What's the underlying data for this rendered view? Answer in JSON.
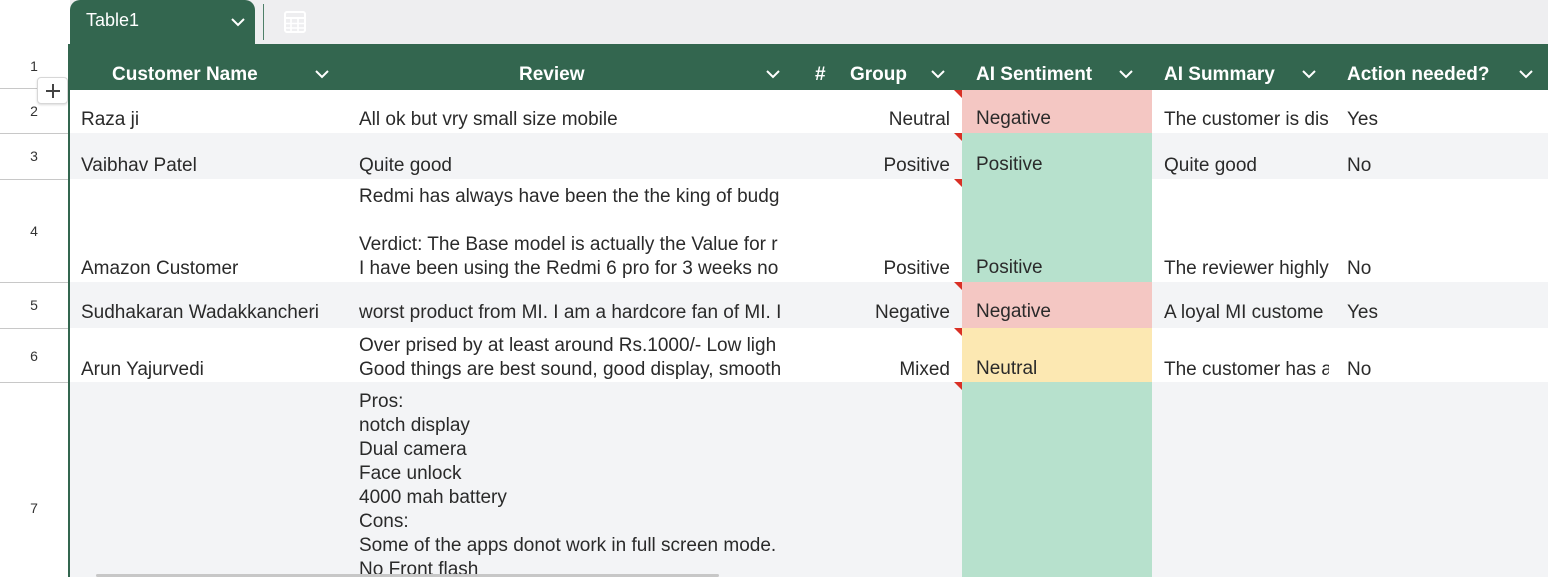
{
  "tab": {
    "name": "Table1",
    "chevron_icon": "chevron-down-icon",
    "table_icon": "table-view-icon"
  },
  "row_numbers": [
    "1",
    "2",
    "3",
    "4",
    "5",
    "6",
    "7"
  ],
  "columns": {
    "customer_name": "Customer Name",
    "review": "Review",
    "group_hash": "#",
    "group": "Group",
    "ai_sentiment": "AI Sentiment",
    "ai_summary": "AI Summary",
    "action_needed": "Action needed?"
  },
  "colors": {
    "header_bg": "#33664f",
    "negative": "#f4c7c3",
    "positive": "#b7e1cd",
    "neutral": "#fce8b2",
    "comment_flag": "#d93025"
  },
  "rows": [
    {
      "customer_name": "Raza ji",
      "review": "All ok but vry small size mobile",
      "group": "Neutral",
      "ai_sentiment": "Negative",
      "ai_summary": "The customer is dis",
      "action_needed": "Yes"
    },
    {
      "customer_name": "Vaibhav Patel",
      "review": "Quite good",
      "group": "Positive",
      "ai_sentiment": "Positive",
      "ai_summary": "Quite good",
      "action_needed": "No"
    },
    {
      "customer_name": "Amazon Customer",
      "review": "Redmi has always have been the the king of budg\n\nVerdict: The Base model is actually the Value for r\nI have been using the Redmi 6 pro for 3 weeks no",
      "group": "Positive",
      "ai_sentiment": "Positive",
      "ai_summary": "The reviewer highly",
      "action_needed": "No"
    },
    {
      "customer_name": "Sudhakaran Wadakkancheri",
      "review": "worst product from MI. I am a hardcore fan of MI. I",
      "group": "Negative",
      "ai_sentiment": "Negative",
      "ai_summary": "A loyal MI custome",
      "action_needed": "Yes"
    },
    {
      "customer_name": "Arun Yajurvedi",
      "review": "Over prised by at least around Rs.1000/- Low ligh\nGood things are best sound, good display, smooth",
      "group": "Mixed",
      "ai_sentiment": "Neutral",
      "ai_summary": "The customer has a",
      "action_needed": "No"
    },
    {
      "customer_name": "",
      "review": "Pros:\nnotch display\nDual camera\nFace unlock\n4000 mah battery\nCons:\nSome of the apps donot work in full screen mode.\nNo Front flash",
      "group": "",
      "ai_sentiment": "",
      "ai_summary": "",
      "action_needed": ""
    }
  ],
  "icons": {
    "add": "plus-icon",
    "header_chevron": "chevron-down-icon"
  }
}
